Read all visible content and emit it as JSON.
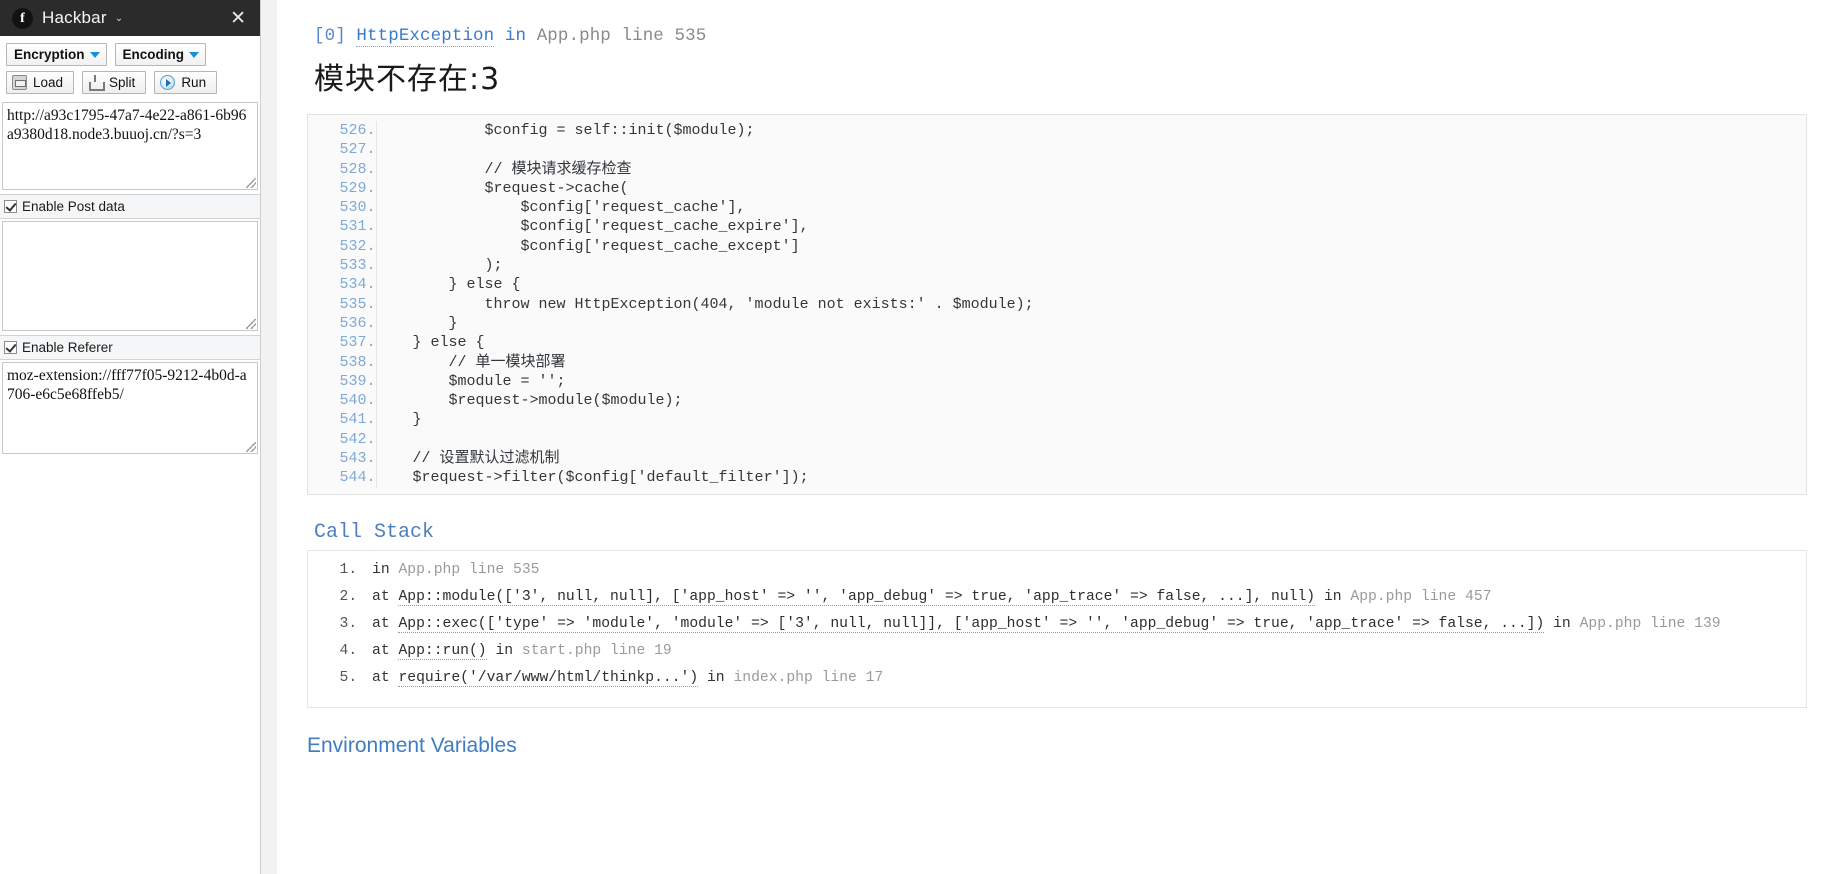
{
  "sidebar": {
    "title": "Hackbar",
    "logo_glyph": "f",
    "caret_glyph": "⌄",
    "close_glyph": "✕",
    "toolbar": {
      "encryption_label": "Encryption",
      "encoding_label": "Encoding"
    },
    "actions": {
      "load_label": "Load",
      "split_label": "Split",
      "run_label": "Run"
    },
    "url_value": "http://a93c1795-47a7-4e22-a861-6b96a9380d18.node3.buuoj.cn/?s=3",
    "post": {
      "checkbox_label": "Enable Post data",
      "checked": true,
      "value": ""
    },
    "referer": {
      "checkbox_label": "Enable Referer",
      "checked": true,
      "value": "moz-extension://fff77f05-9212-4b0d-a706-e6c5e68ffeb5/"
    }
  },
  "main": {
    "exception": {
      "index": "[0]",
      "type": "HttpException",
      "in_word": "in",
      "file": "App.php line 535",
      "message": "模块不存在:3"
    },
    "code": {
      "lines": [
        {
          "no": "526.",
          "text": "            $config = self::init($module);"
        },
        {
          "no": "527.",
          "text": ""
        },
        {
          "no": "528.",
          "text": "            // 模块请求缓存检查"
        },
        {
          "no": "529.",
          "text": "            $request->cache("
        },
        {
          "no": "530.",
          "text": "                $config['request_cache'],"
        },
        {
          "no": "531.",
          "text": "                $config['request_cache_expire'],"
        },
        {
          "no": "532.",
          "text": "                $config['request_cache_except']"
        },
        {
          "no": "533.",
          "text": "            );"
        },
        {
          "no": "534.",
          "text": "        } else {"
        },
        {
          "no": "535.",
          "text": "            throw new HttpException(404, 'module not exists:' . $module);"
        },
        {
          "no": "536.",
          "text": "        }"
        },
        {
          "no": "537.",
          "text": "    } else {"
        },
        {
          "no": "538.",
          "text": "        // 单一模块部署"
        },
        {
          "no": "539.",
          "text": "        $module = '';"
        },
        {
          "no": "540.",
          "text": "        $request->module($module);"
        },
        {
          "no": "541.",
          "text": "    }"
        },
        {
          "no": "542.",
          "text": ""
        },
        {
          "no": "543.",
          "text": "    // 设置默认过滤机制"
        },
        {
          "no": "544.",
          "text": "    $request->filter($config['default_filter']);"
        }
      ]
    },
    "call_stack": {
      "title": "Call Stack",
      "items": [
        {
          "n": "1.",
          "verb": "in",
          "call": "",
          "file": "App.php line 535"
        },
        {
          "n": "2.",
          "verb": "at",
          "call": "App::module(['3', null, null], ['app_host' => '', 'app_debug' => true, 'app_trace' => false, ...], null)",
          "in": "in",
          "file": "App.php line 457"
        },
        {
          "n": "3.",
          "verb": "at",
          "call": "App::exec(['type' => 'module', 'module' => ['3', null, null]], ['app_host' => '', 'app_debug' => true, 'app_trace' => false, ...])",
          "in": "in",
          "file": "App.php line 139"
        },
        {
          "n": "4.",
          "verb": "at",
          "call": "App::run()",
          "in": "in",
          "file": "start.php line 19"
        },
        {
          "n": "5.",
          "verb": "at",
          "call": "require('/var/www/html/thinkp...')",
          "in": "in",
          "file": "index.php line 17"
        }
      ]
    },
    "env_title": "Environment Variables"
  },
  "colors": {
    "accent_blue": "#3b7bc8",
    "line_number_blue": "#7fa9d6",
    "titlebar": "#2b2b2b",
    "dropdown_arrow": "#1b8fd6"
  }
}
